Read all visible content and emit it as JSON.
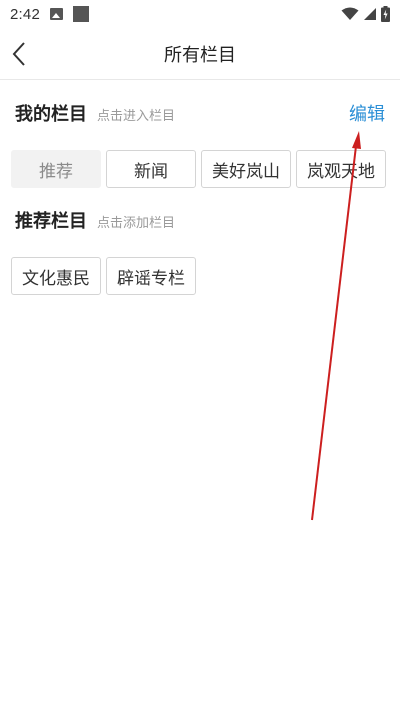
{
  "status_bar": {
    "time": "2:42",
    "icons": [
      "image-icon",
      "square-icon",
      "wifi-icon",
      "signal-icon",
      "battery-charging-icon"
    ]
  },
  "header": {
    "back_icon": "chevron-left-icon",
    "title": "所有栏目"
  },
  "my_channels": {
    "title": "我的栏目",
    "hint": "点击进入栏目",
    "edit_label": "编辑",
    "items": [
      {
        "label": "推荐",
        "fixed": true
      },
      {
        "label": "新闻",
        "fixed": false
      },
      {
        "label": "美好岚山",
        "fixed": false
      },
      {
        "label": "岚观天地",
        "fixed": false
      }
    ]
  },
  "recommended_channels": {
    "title": "推荐栏目",
    "hint": "点击添加栏目",
    "items": [
      {
        "label": "文化惠民"
      },
      {
        "label": "辟谣专栏"
      }
    ]
  },
  "colors": {
    "accent": "#2b8fd6",
    "annotation_arrow": "#cc1f1f",
    "chip_border": "#d4d4d4",
    "fixed_chip_bg": "#f2f2f2"
  }
}
